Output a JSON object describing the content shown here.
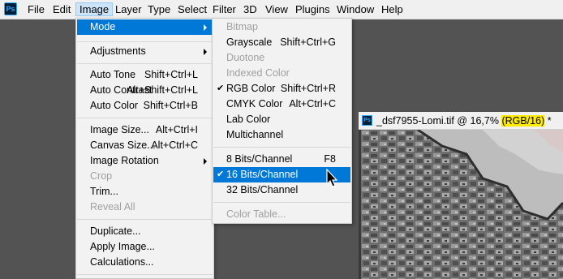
{
  "menubar": {
    "logo_text": "Ps",
    "items": [
      {
        "label": "File"
      },
      {
        "label": "Edit"
      },
      {
        "label": "Image"
      },
      {
        "label": "Layer"
      },
      {
        "label": "Type"
      },
      {
        "label": "Select"
      },
      {
        "label": "Filter"
      },
      {
        "label": "3D"
      },
      {
        "label": "View"
      },
      {
        "label": "Plugins"
      },
      {
        "label": "Window"
      },
      {
        "label": "Help"
      }
    ]
  },
  "image_menu": {
    "items": [
      {
        "label": "Mode",
        "has_submenu": true,
        "highlighted": true
      },
      {
        "label": "Adjustments",
        "has_submenu": true
      },
      {
        "label": "Auto Tone",
        "shortcut": "Shift+Ctrl+L"
      },
      {
        "label": "Auto Contrast",
        "shortcut": "Alt+Shift+Ctrl+L"
      },
      {
        "label": "Auto Color",
        "shortcut": "Shift+Ctrl+B"
      },
      {
        "label": "Image Size...",
        "shortcut": "Alt+Ctrl+I"
      },
      {
        "label": "Canvas Size...",
        "shortcut": "Alt+Ctrl+C"
      },
      {
        "label": "Image Rotation",
        "has_submenu": true
      },
      {
        "label": "Crop",
        "disabled": true
      },
      {
        "label": "Trim..."
      },
      {
        "label": "Reveal All",
        "disabled": true
      },
      {
        "label": "Duplicate..."
      },
      {
        "label": "Apply Image..."
      },
      {
        "label": "Calculations..."
      }
    ]
  },
  "mode_submenu": {
    "items": [
      {
        "label": "Bitmap",
        "disabled": true
      },
      {
        "label": "Grayscale",
        "shortcut": "Shift+Ctrl+G"
      },
      {
        "label": "Duotone",
        "disabled": true
      },
      {
        "label": "Indexed Color",
        "disabled": true
      },
      {
        "label": "RGB Color",
        "shortcut": "Shift+Ctrl+R",
        "checked": true
      },
      {
        "label": "CMYK Color",
        "shortcut": "Alt+Ctrl+C"
      },
      {
        "label": "Lab Color"
      },
      {
        "label": "Multichannel"
      },
      {
        "label": "8 Bits/Channel",
        "shortcut": "F8"
      },
      {
        "label": "16 Bits/Channel",
        "checked": true,
        "highlighted": true
      },
      {
        "label": "32 Bits/Channel"
      },
      {
        "label": "Color Table...",
        "disabled": true
      }
    ],
    "check_glyph": "✔"
  },
  "document": {
    "logo_text": "Ps",
    "title_prefix": "_dsf7955-Lomi.tif @ 16,7% ",
    "mode_label": "(RGB/16)",
    "title_suffix": " *"
  },
  "colors": {
    "menu_highlight": "#0078d7",
    "mode_highlight": "#ffeb00",
    "workspace": "#535353"
  }
}
